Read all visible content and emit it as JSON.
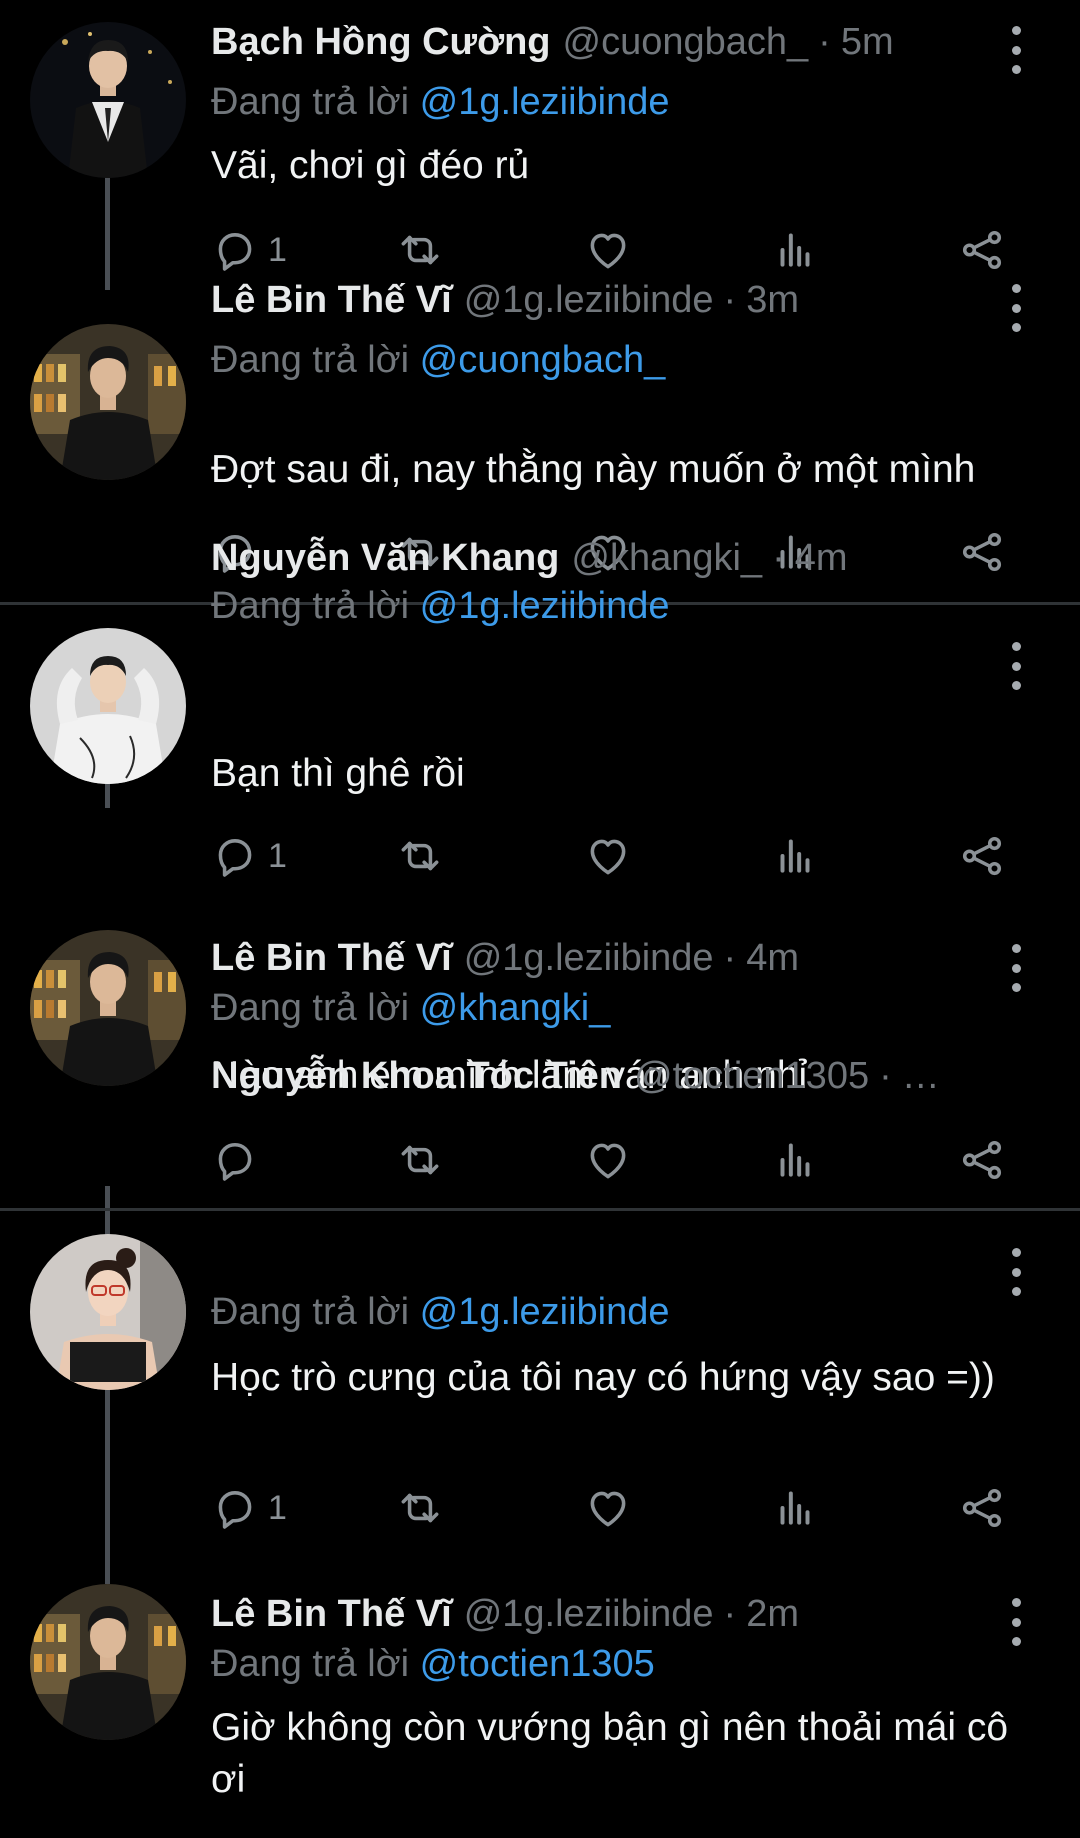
{
  "replying_prefix": "Đang trả lời ",
  "tweets": [
    {
      "name": "Bạch Hồng Cường",
      "handle": "@cuongbach_",
      "time": "5m",
      "reply_to": "@1g.leziibinde",
      "text": "Vãi, chơi gì đéo rủ",
      "reply_count": "1"
    },
    {
      "name": "Lê Bin Thế Vĩ",
      "handle": "@1g.leziibinde",
      "time": "3m",
      "reply_to": "@cuongbach_",
      "text": "Đợt sau đi, nay thằng này muốn ở một mình",
      "reply_count": ""
    },
    {
      "name": "Nguyễn Văn Khang",
      "handle": "@khangki_",
      "time": "4m",
      "reply_to": "@1g.leziibinde",
      "text": "Bạn thì ghê rồi",
      "reply_count": "1"
    },
    {
      "name": "Lê Bin Thế Vĩ",
      "handle": "@1g.leziibinde",
      "time": "4m",
      "reply_to": "@khangki_",
      "text": "Nào anh em mình làm ván anh nhỉ",
      "reply_count": ""
    },
    {
      "name": "Nguyễn Khoa Tóc Tiên",
      "handle": "@toctien1305",
      "time": "…",
      "reply_to": "@1g.leziibinde",
      "text": "Học trò cưng của tôi nay có hứng vậy sao =))",
      "reply_count": "1"
    },
    {
      "name": "Lê Bin Thế Vĩ",
      "handle": "@1g.leziibinde",
      "time": "2m",
      "reply_to": "@toctien1305",
      "text": "Giờ không còn vướng bận gì nên thoải mái cô ơi",
      "reply_count": ""
    }
  ],
  "icons": {
    "reply": "reply-icon",
    "retweet": "retweet-icon",
    "like": "heart-icon",
    "views": "views-icon",
    "share": "share-icon",
    "more": "more-vertical-icon"
  },
  "colors": {
    "background": "#000000",
    "mention": "#3d9be9",
    "muted": "#71767b",
    "text": "#e7e9ea"
  }
}
